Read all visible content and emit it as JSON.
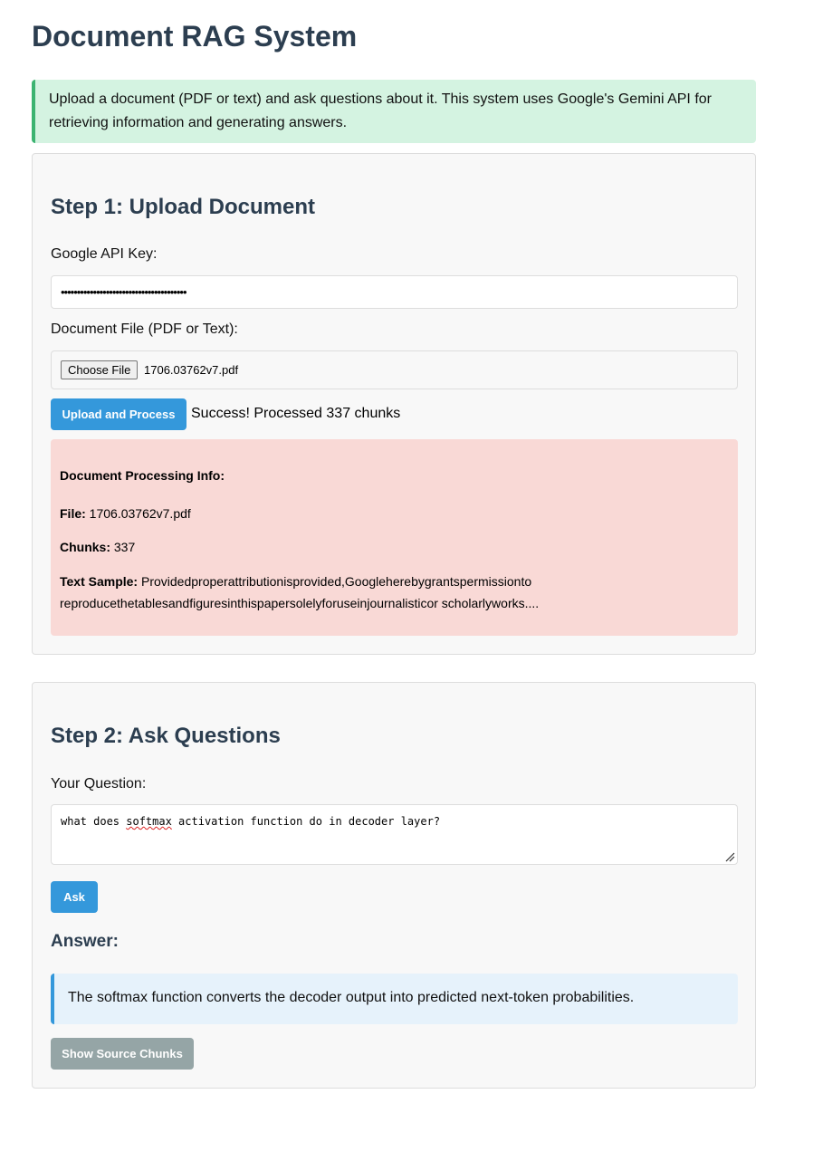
{
  "page": {
    "title": "Document RAG System",
    "intro": "Upload a document (PDF or text) and ask questions about it. This system uses Google's Gemini API for retrieving information and generating answers."
  },
  "step1": {
    "heading": "Step 1: Upload Document",
    "api_key_label": "Google API Key:",
    "api_key_value": "•••••••••••••••••••••••••••••••••••••••",
    "file_label": "Document File (PDF or Text):",
    "choose_file_label": "Choose File",
    "file_name": "1706.03762v7.pdf",
    "upload_button": "Upload and Process",
    "status": "Success! Processed 337 chunks",
    "info": {
      "heading": "Document Processing Info:",
      "file_key": "File:",
      "file_value": "1706.03762v7.pdf",
      "chunks_key": "Chunks:",
      "chunks_value": "337",
      "sample_key": "Text Sample:",
      "sample_line1": "Providedproperattributionisprovided,Googleherebygrantspermissionto",
      "sample_line2": "reproducethetablesandfiguresinthispapersolelyforuseinjournalisticor scholarlyworks...."
    }
  },
  "step2": {
    "heading": "Step 2: Ask Questions",
    "question_label": "Your Question:",
    "question_before": "what does ",
    "question_misspelled": "softmax",
    "question_after": " activation function do in decoder layer?",
    "ask_button": "Ask",
    "answer_heading": "Answer:",
    "answer_text": "The softmax function converts the decoder output into predicted next-token probabilities.",
    "show_sources_button": "Show Source Chunks"
  },
  "colors": {
    "heading": "#2c3e50",
    "primary_button": "#3498db",
    "disabled_button": "#95a5a6",
    "intro_bg": "#d4f3e1",
    "intro_border": "#3cb371",
    "info_bg": "#f9d9d6",
    "answer_bg": "#e6f2fb"
  },
  "icons": {
    "textarea_resize": "resize-handle-icon"
  }
}
